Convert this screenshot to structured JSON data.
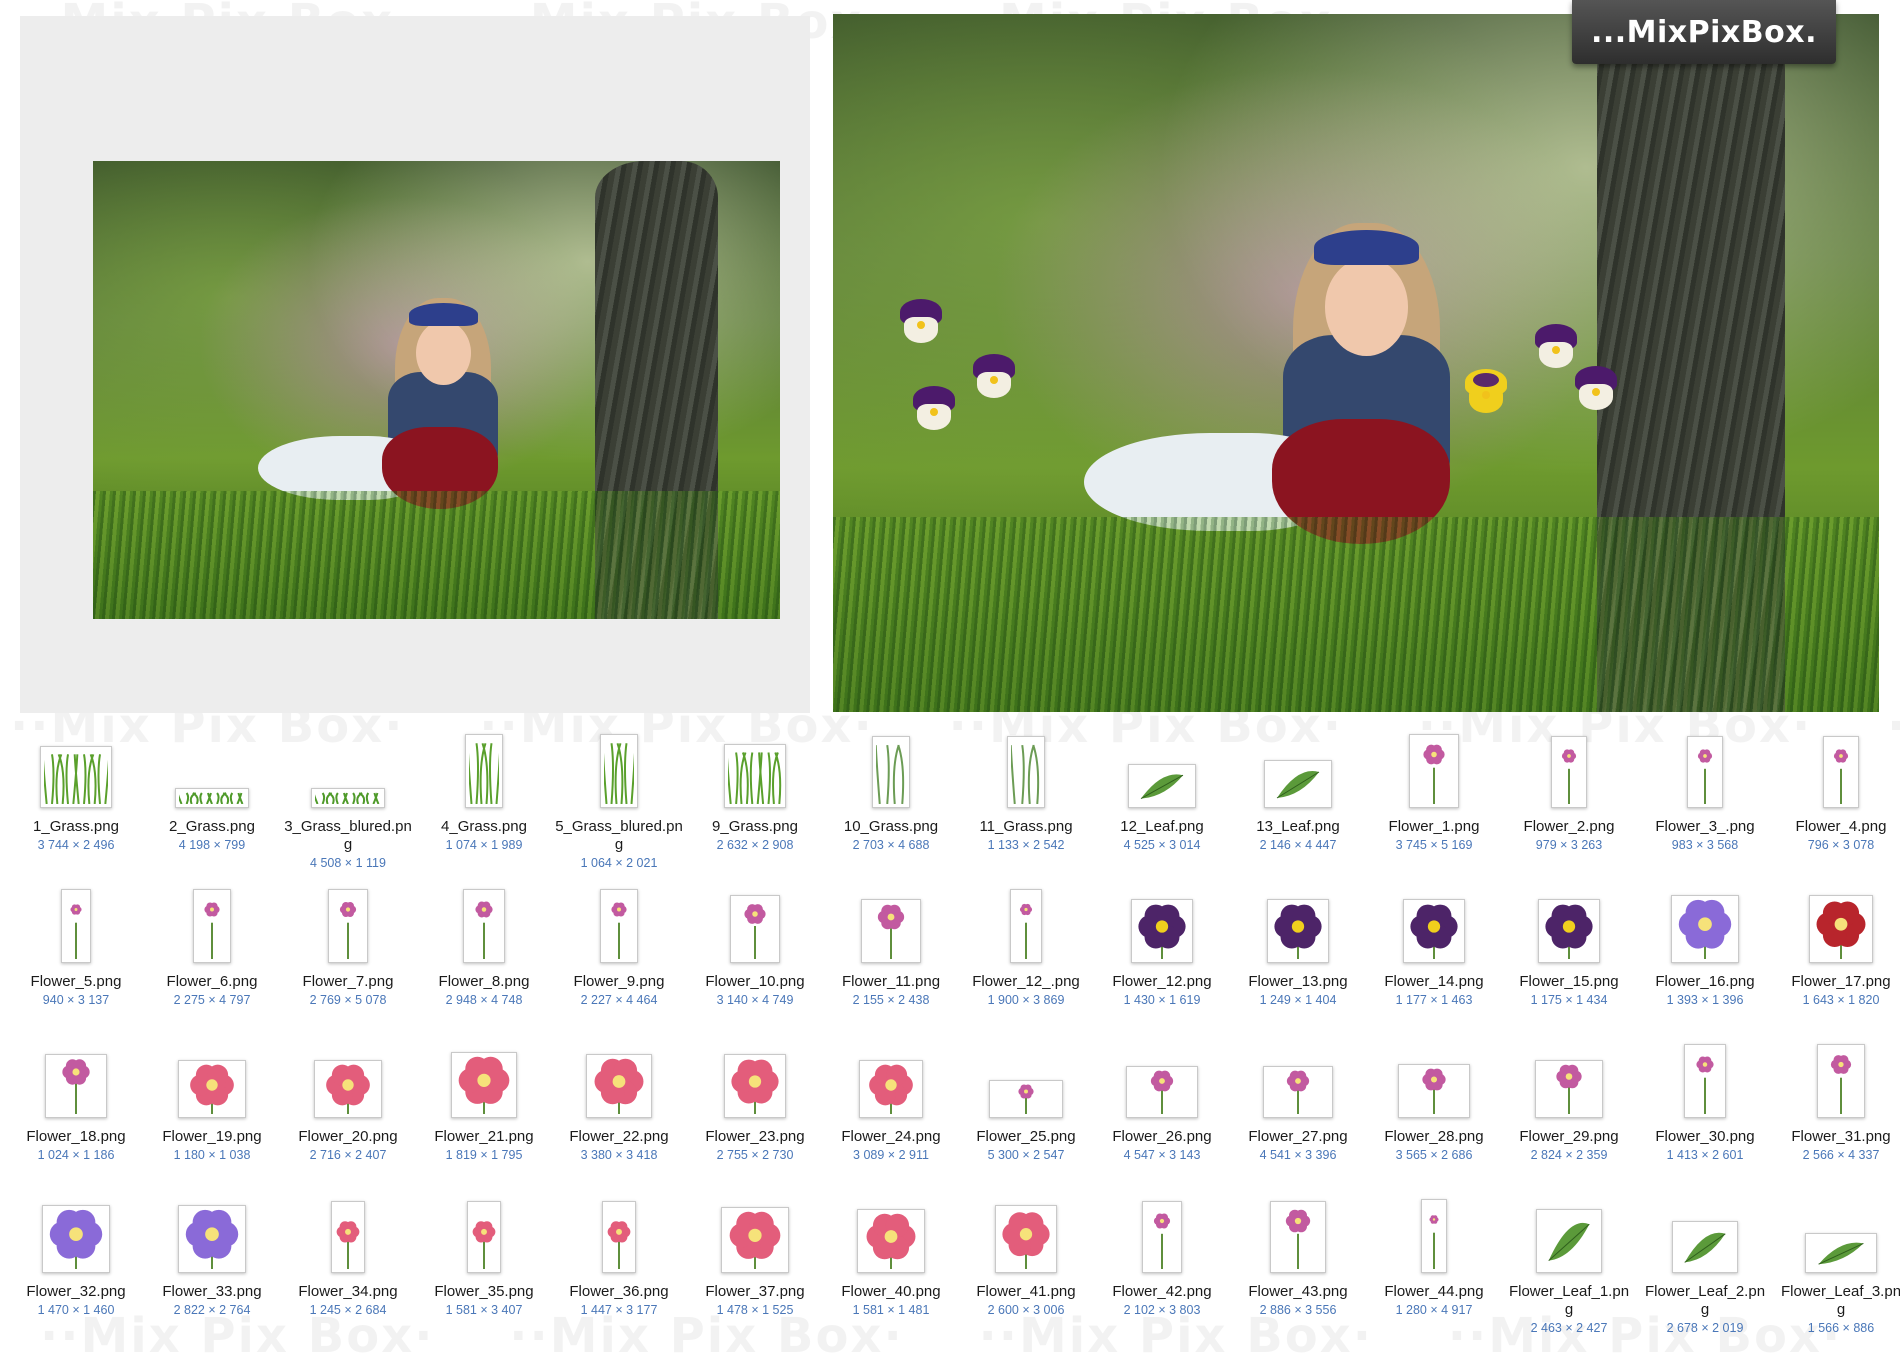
{
  "brand": {
    "logo_text": "...MixPixBox.",
    "watermark_text": "··Mix Pix Box·"
  },
  "colors": {
    "filename": "#1b1b1b",
    "dimensions": "#4a77b8",
    "panel_bg": "#ededed"
  },
  "files": [
    {
      "name": "1_Grass.png",
      "dims": "3 744 × 2 496",
      "icon": "grass-icon"
    },
    {
      "name": "2_Grass.png",
      "dims": "4 198 × 799",
      "icon": "grass-strip-icon"
    },
    {
      "name": "3_Grass_blured.png",
      "dims": "4 508 × 1 119",
      "icon": "grass-strip-icon"
    },
    {
      "name": "4_Grass.png",
      "dims": "1 074 × 1 989",
      "icon": "grass-icon"
    },
    {
      "name": "5_Grass_blured.png",
      "dims": "1 064 × 2 021",
      "icon": "grass-icon"
    },
    {
      "name": "9_Grass.png",
      "dims": "2 632 × 2 908",
      "icon": "grass-icon"
    },
    {
      "name": "10_Grass.png",
      "dims": "2 703 × 4 688",
      "icon": "grass-blade-icon"
    },
    {
      "name": "11_Grass.png",
      "dims": "1 133 × 2 542",
      "icon": "grass-blade-icon"
    },
    {
      "name": "12_Leaf.png",
      "dims": "4 525 × 3 014",
      "icon": "leaf-icon"
    },
    {
      "name": "13_Leaf.png",
      "dims": "2 146 × 4 447",
      "icon": "leaf-icon"
    },
    {
      "name": "Flower_1.png",
      "dims": "3 745 × 5 169",
      "icon": "flower-icon"
    },
    {
      "name": "Flower_2.png",
      "dims": "979 × 3 263",
      "icon": "flower-icon"
    },
    {
      "name": "Flower_3_.png",
      "dims": "983 × 3 568",
      "icon": "flower-icon"
    },
    {
      "name": "Flower_4.png",
      "dims": "796 × 3 078",
      "icon": "flower-icon"
    },
    {
      "name": "Flower_5.png",
      "dims": "940 × 3 137",
      "icon": "flower-icon"
    },
    {
      "name": "Flower_6.png",
      "dims": "2 275 × 4 797",
      "icon": "flower-icon"
    },
    {
      "name": "Flower_7.png",
      "dims": "2 769 × 5 078",
      "icon": "flower-icon"
    },
    {
      "name": "Flower_8.png",
      "dims": "2 948 × 4 748",
      "icon": "flower-icon"
    },
    {
      "name": "Flower_9.png",
      "dims": "2 227 × 4 464",
      "icon": "flower-icon"
    },
    {
      "name": "Flower_10.png",
      "dims": "3 140 × 4 749",
      "icon": "flower-icon"
    },
    {
      "name": "Flower_11.png",
      "dims": "2 155 × 2 438",
      "icon": "flower-icon"
    },
    {
      "name": "Flower_12_.png",
      "dims": "1 900 × 3 869",
      "icon": "flower-icon"
    },
    {
      "name": "Flower_12.png",
      "dims": "1 430 × 1 619",
      "icon": "pansy-icon"
    },
    {
      "name": "Flower_13.png",
      "dims": "1 249 × 1 404",
      "icon": "pansy-icon"
    },
    {
      "name": "Flower_14.png",
      "dims": "1 177 × 1 463",
      "icon": "pansy-icon"
    },
    {
      "name": "Flower_15.png",
      "dims": "1 175 × 1 434",
      "icon": "pansy-icon"
    },
    {
      "name": "Flower_16.png",
      "dims": "1 393 × 1 396",
      "icon": "clematis-icon"
    },
    {
      "name": "Flower_17.png",
      "dims": "1 643 × 1 820",
      "icon": "lily-icon"
    },
    {
      "name": "Flower_18.png",
      "dims": "1 024 × 1 186",
      "icon": "flower-icon"
    },
    {
      "name": "Flower_19.png",
      "dims": "1 180 × 1 038",
      "icon": "rose-icon"
    },
    {
      "name": "Flower_20.png",
      "dims": "2 716 × 2 407",
      "icon": "rose-icon"
    },
    {
      "name": "Flower_21.png",
      "dims": "1 819 × 1 795",
      "icon": "rose-icon"
    },
    {
      "name": "Flower_22.png",
      "dims": "3 380 × 3 418",
      "icon": "rose-icon"
    },
    {
      "name": "Flower_23.png",
      "dims": "2 755 × 2 730",
      "icon": "rose-icon"
    },
    {
      "name": "Flower_24.png",
      "dims": "3 089 × 2 911",
      "icon": "rose-icon"
    },
    {
      "name": "Flower_25.png",
      "dims": "5 300 × 2 547",
      "icon": "flower-icon"
    },
    {
      "name": "Flower_26.png",
      "dims": "4 547 × 3 143",
      "icon": "flower-icon"
    },
    {
      "name": "Flower_27.png",
      "dims": "4 541 × 3 396",
      "icon": "flower-icon"
    },
    {
      "name": "Flower_28.png",
      "dims": "3 565 × 2 686",
      "icon": "flower-icon"
    },
    {
      "name": "Flower_29.png",
      "dims": "2 824 × 2 359",
      "icon": "flower-icon"
    },
    {
      "name": "Flower_30.png",
      "dims": "1 413 × 2 601",
      "icon": "flower-icon"
    },
    {
      "name": "Flower_31.png",
      "dims": "2 566 × 4 337",
      "icon": "flower-icon"
    },
    {
      "name": "Flower_32.png",
      "dims": "1 470 × 1 460",
      "icon": "clematis-icon"
    },
    {
      "name": "Flower_33.png",
      "dims": "2 822 × 2 764",
      "icon": "clematis-icon"
    },
    {
      "name": "Flower_34.png",
      "dims": "1 245 × 2 684",
      "icon": "rose-icon"
    },
    {
      "name": "Flower_35.png",
      "dims": "1 581 × 3 407",
      "icon": "rose-icon"
    },
    {
      "name": "Flower_36.png",
      "dims": "1 447 × 3 177",
      "icon": "rose-icon"
    },
    {
      "name": "Flower_37.png",
      "dims": "1 478 × 1 525",
      "icon": "rose-icon"
    },
    {
      "name": "Flower_40.png",
      "dims": "1 581 × 1 481",
      "icon": "rose-icon"
    },
    {
      "name": "Flower_41.png",
      "dims": "2 600 × 3 006",
      "icon": "rose-icon"
    },
    {
      "name": "Flower_42.png",
      "dims": "2 102 × 3 803",
      "icon": "flower-icon"
    },
    {
      "name": "Flower_43.png",
      "dims": "2 886 × 3 556",
      "icon": "flower-icon"
    },
    {
      "name": "Flower_44.png",
      "dims": "1 280 × 4 917",
      "icon": "flower-icon"
    },
    {
      "name": "Flower_Leaf_1.png",
      "dims": "2 463 × 2 427",
      "icon": "leaf-icon"
    },
    {
      "name": "Flower_Leaf_2.png",
      "dims": "2 678 × 2 019",
      "icon": "leaf-icon"
    },
    {
      "name": "Flower_Leaf_3.png",
      "dims": "1 566 × 886",
      "icon": "leaf-icon"
    }
  ]
}
